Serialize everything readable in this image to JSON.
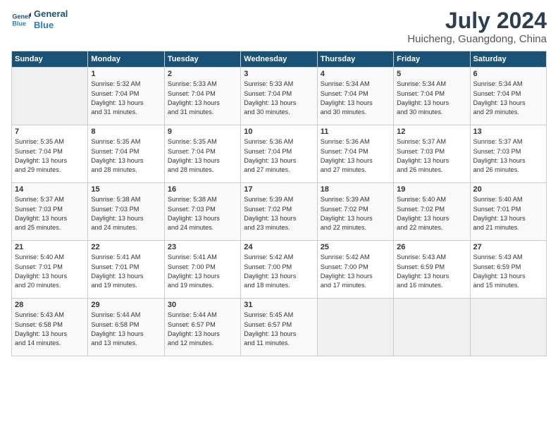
{
  "logo": {
    "line1": "General",
    "line2": "Blue"
  },
  "title": "July 2024",
  "subtitle": "Huicheng, Guangdong, China",
  "days_of_week": [
    "Sunday",
    "Monday",
    "Tuesday",
    "Wednesday",
    "Thursday",
    "Friday",
    "Saturday"
  ],
  "weeks": [
    [
      {
        "day": "",
        "info": ""
      },
      {
        "day": "1",
        "info": "Sunrise: 5:32 AM\nSunset: 7:04 PM\nDaylight: 13 hours\nand 31 minutes."
      },
      {
        "day": "2",
        "info": "Sunrise: 5:33 AM\nSunset: 7:04 PM\nDaylight: 13 hours\nand 31 minutes."
      },
      {
        "day": "3",
        "info": "Sunrise: 5:33 AM\nSunset: 7:04 PM\nDaylight: 13 hours\nand 30 minutes."
      },
      {
        "day": "4",
        "info": "Sunrise: 5:34 AM\nSunset: 7:04 PM\nDaylight: 13 hours\nand 30 minutes."
      },
      {
        "day": "5",
        "info": "Sunrise: 5:34 AM\nSunset: 7:04 PM\nDaylight: 13 hours\nand 30 minutes."
      },
      {
        "day": "6",
        "info": "Sunrise: 5:34 AM\nSunset: 7:04 PM\nDaylight: 13 hours\nand 29 minutes."
      }
    ],
    [
      {
        "day": "7",
        "info": "Sunrise: 5:35 AM\nSunset: 7:04 PM\nDaylight: 13 hours\nand 29 minutes."
      },
      {
        "day": "8",
        "info": "Sunrise: 5:35 AM\nSunset: 7:04 PM\nDaylight: 13 hours\nand 28 minutes."
      },
      {
        "day": "9",
        "info": "Sunrise: 5:35 AM\nSunset: 7:04 PM\nDaylight: 13 hours\nand 28 minutes."
      },
      {
        "day": "10",
        "info": "Sunrise: 5:36 AM\nSunset: 7:04 PM\nDaylight: 13 hours\nand 27 minutes."
      },
      {
        "day": "11",
        "info": "Sunrise: 5:36 AM\nSunset: 7:04 PM\nDaylight: 13 hours\nand 27 minutes."
      },
      {
        "day": "12",
        "info": "Sunrise: 5:37 AM\nSunset: 7:03 PM\nDaylight: 13 hours\nand 26 minutes."
      },
      {
        "day": "13",
        "info": "Sunrise: 5:37 AM\nSunset: 7:03 PM\nDaylight: 13 hours\nand 26 minutes."
      }
    ],
    [
      {
        "day": "14",
        "info": "Sunrise: 5:37 AM\nSunset: 7:03 PM\nDaylight: 13 hours\nand 25 minutes."
      },
      {
        "day": "15",
        "info": "Sunrise: 5:38 AM\nSunset: 7:03 PM\nDaylight: 13 hours\nand 24 minutes."
      },
      {
        "day": "16",
        "info": "Sunrise: 5:38 AM\nSunset: 7:03 PM\nDaylight: 13 hours\nand 24 minutes."
      },
      {
        "day": "17",
        "info": "Sunrise: 5:39 AM\nSunset: 7:02 PM\nDaylight: 13 hours\nand 23 minutes."
      },
      {
        "day": "18",
        "info": "Sunrise: 5:39 AM\nSunset: 7:02 PM\nDaylight: 13 hours\nand 22 minutes."
      },
      {
        "day": "19",
        "info": "Sunrise: 5:40 AM\nSunset: 7:02 PM\nDaylight: 13 hours\nand 22 minutes."
      },
      {
        "day": "20",
        "info": "Sunrise: 5:40 AM\nSunset: 7:01 PM\nDaylight: 13 hours\nand 21 minutes."
      }
    ],
    [
      {
        "day": "21",
        "info": "Sunrise: 5:40 AM\nSunset: 7:01 PM\nDaylight: 13 hours\nand 20 minutes."
      },
      {
        "day": "22",
        "info": "Sunrise: 5:41 AM\nSunset: 7:01 PM\nDaylight: 13 hours\nand 19 minutes."
      },
      {
        "day": "23",
        "info": "Sunrise: 5:41 AM\nSunset: 7:00 PM\nDaylight: 13 hours\nand 19 minutes."
      },
      {
        "day": "24",
        "info": "Sunrise: 5:42 AM\nSunset: 7:00 PM\nDaylight: 13 hours\nand 18 minutes."
      },
      {
        "day": "25",
        "info": "Sunrise: 5:42 AM\nSunset: 7:00 PM\nDaylight: 13 hours\nand 17 minutes."
      },
      {
        "day": "26",
        "info": "Sunrise: 5:43 AM\nSunset: 6:59 PM\nDaylight: 13 hours\nand 16 minutes."
      },
      {
        "day": "27",
        "info": "Sunrise: 5:43 AM\nSunset: 6:59 PM\nDaylight: 13 hours\nand 15 minutes."
      }
    ],
    [
      {
        "day": "28",
        "info": "Sunrise: 5:43 AM\nSunset: 6:58 PM\nDaylight: 13 hours\nand 14 minutes."
      },
      {
        "day": "29",
        "info": "Sunrise: 5:44 AM\nSunset: 6:58 PM\nDaylight: 13 hours\nand 13 minutes."
      },
      {
        "day": "30",
        "info": "Sunrise: 5:44 AM\nSunset: 6:57 PM\nDaylight: 13 hours\nand 12 minutes."
      },
      {
        "day": "31",
        "info": "Sunrise: 5:45 AM\nSunset: 6:57 PM\nDaylight: 13 hours\nand 11 minutes."
      },
      {
        "day": "",
        "info": ""
      },
      {
        "day": "",
        "info": ""
      },
      {
        "day": "",
        "info": ""
      }
    ]
  ]
}
